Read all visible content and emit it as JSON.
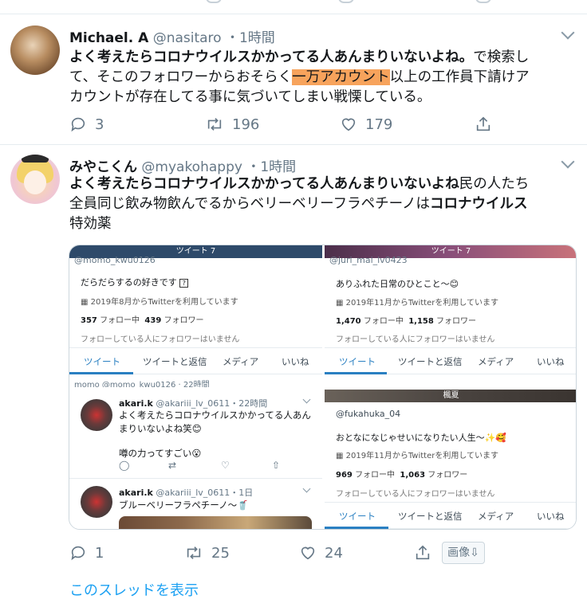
{
  "tweet1": {
    "name": "Michael. A",
    "handle": "@nasitaro",
    "separator": "・",
    "time": "1時間",
    "text_bold": "よく考えたらコロナウイルスかかってる人あんまりいないよね。",
    "text_1": "で検索し",
    "text_2": "て、そこのフォロワーからおそらく",
    "text_highlight": "一万アカウント",
    "text_3": "以上の工作員下請けア",
    "text_4": "カウントが存在してる事に気づいてしまい戦慄している。",
    "replies": "3",
    "retweets": "196",
    "likes": "179"
  },
  "tweet2": {
    "name": "みやこくん",
    "handle": "@myakohappy",
    "separator": "・",
    "time": "1時間",
    "text_bold": "よく考えたらコロナウイルスかかってる人あんまりいないよね",
    "text_1": "民の人たち",
    "text_2": "全員同じ飲み物飲んでるからベリーベリーフラペチーノは",
    "text_bold2": "コロナウイルス",
    "text_3": "特効薬",
    "replies": "1",
    "retweets": "25",
    "likes": "24",
    "image_button": "画像⇩",
    "show_thread": "このスレッドを表示"
  },
  "media": {
    "p1": {
      "bar": "ツイート 7",
      "handle_cut": "@momo_kwu0126",
      "bio": "だらだらするの好きです",
      "joined": "2019年8月からTwitterを利用しています",
      "following": "357",
      "following_label": "フォロー中",
      "followers": "439",
      "followers_label": "フォロワー",
      "note": "フォローしている人にフォロワーはいません",
      "bottom_cut": "momo @momo_kwu0126 · 22時間"
    },
    "p2": {
      "bar": "ツイート 7",
      "handle_cut": "@juri_mai_lv0423",
      "bio": "ありふれた日常のひとこと〜😊",
      "joined": "2019年11月からTwitterを利用しています",
      "following": "1,470",
      "following_label": "フォロー中",
      "followers": "1,158",
      "followers_label": "フォロワー",
      "note": "フォローしている人にフォロワーはいません"
    },
    "p3": {
      "t1_name": "akari.k",
      "t1_handle": "@akariii_lv_0611・22時間",
      "t1_line1": "よく考えたらコロナウイルスかかってる人あん",
      "t1_line2": "まりいないよね笑😊",
      "t1_line3": "噂の力ってすごい😮",
      "t2_name": "akari.k",
      "t2_handle": "@akariii_lv_0611・1日",
      "t2_line1": "ブルーベリーフラペチーノ〜🥤"
    },
    "p4": {
      "bar": "楓夏",
      "handle": "@fukahuka_04",
      "bio": "おとなになじゃせいになりたい人生〜✨🥰",
      "joined": "2019年11月からTwitterを利用しています",
      "following": "969",
      "following_label": "フォロー中",
      "followers": "1,063",
      "followers_label": "フォロワー",
      "note": "フォローしている人にフォロワーはいません"
    },
    "tabs": [
      "ツイート",
      "ツイートと返信",
      "メディア",
      "いいね"
    ]
  },
  "colors": {
    "accent": "#1da1f2",
    "highlight": "#f7a35c",
    "muted": "#657786"
  }
}
